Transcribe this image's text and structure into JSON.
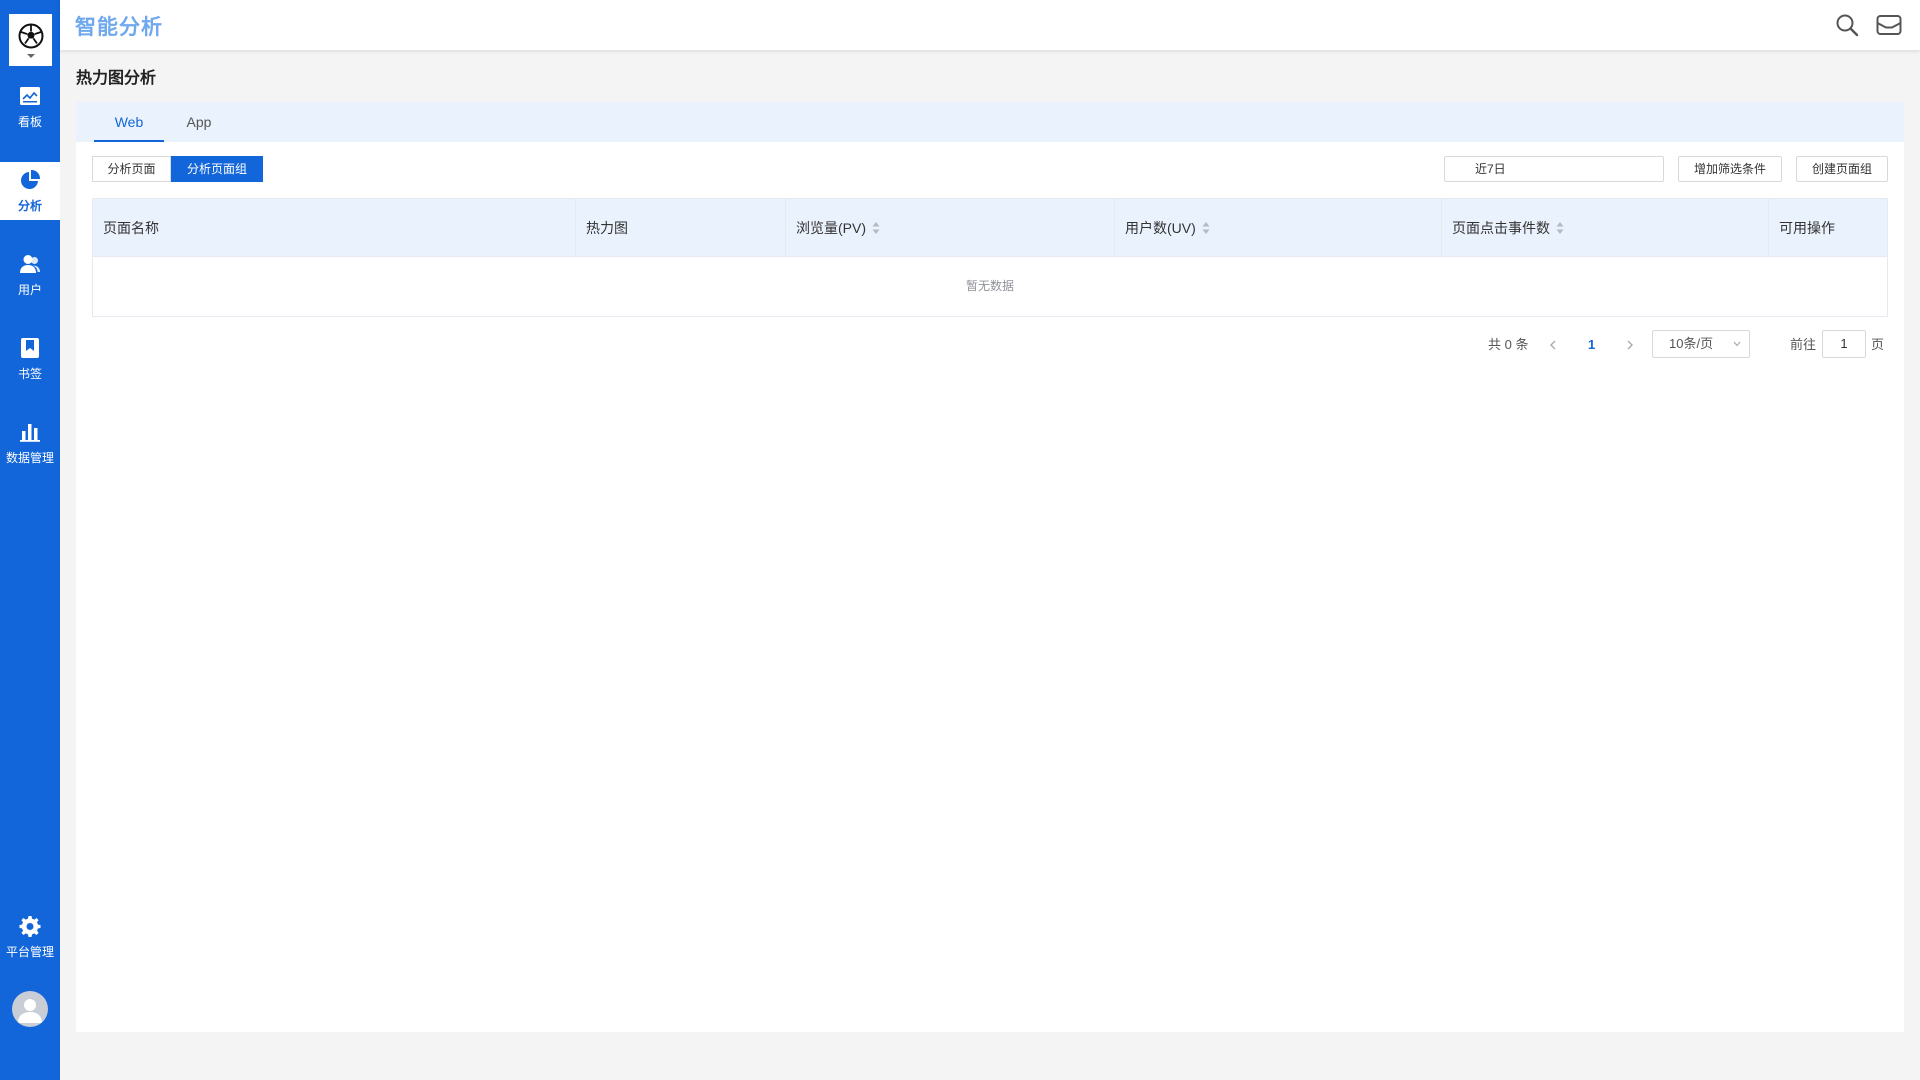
{
  "app": {
    "title": "智能分析"
  },
  "sidebar": {
    "items": [
      {
        "label": "看板",
        "icon": "dashboard-icon"
      },
      {
        "label": "分析",
        "icon": "pie-chart-icon",
        "active": true
      },
      {
        "label": "用户",
        "icon": "users-icon"
      },
      {
        "label": "书签",
        "icon": "bookmark-icon"
      },
      {
        "label": "数据管理",
        "icon": "bar-chart-icon"
      }
    ],
    "bottom": {
      "label": "平台管理",
      "icon": "gear-icon"
    }
  },
  "page": {
    "title": "热力图分析"
  },
  "tabs": [
    {
      "label": "Web",
      "active": true
    },
    {
      "label": "App",
      "active": false
    }
  ],
  "segments": [
    {
      "label": "分析页面",
      "active": false
    },
    {
      "label": "分析页面组",
      "active": true
    }
  ],
  "toolbar": {
    "date_range": "近7日",
    "add_filter_label": "增加筛选条件",
    "create_group_label": "创建页面组"
  },
  "table": {
    "columns": [
      "页面名称",
      "热力图",
      "浏览量(PV)",
      "用户数(UV)",
      "页面点击事件数",
      "可用操作"
    ],
    "sortable": [
      false,
      false,
      true,
      true,
      true,
      false
    ],
    "rows": [],
    "empty_text": "暂无数据"
  },
  "pagination": {
    "total_text": "共 0 条",
    "current_page": "1",
    "page_size": "10条/页",
    "goto_prefix": "前往",
    "goto_value": "1",
    "goto_suffix": "页"
  },
  "colors": {
    "primary": "#1366d9",
    "header_bg": "#eaf2fd",
    "title": "#6fa8ee"
  }
}
